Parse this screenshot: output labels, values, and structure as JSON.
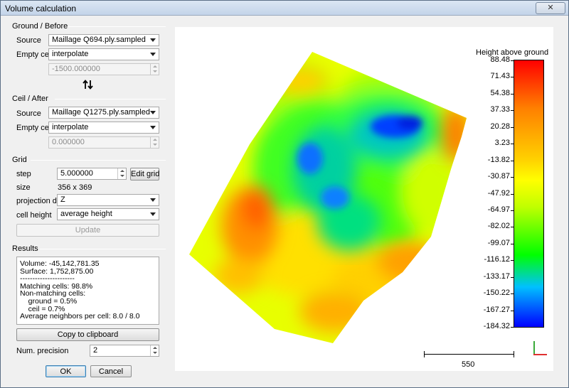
{
  "window": {
    "title": "Volume calculation",
    "close_label": "✕"
  },
  "ground": {
    "title": "Ground / Before",
    "source_label": "Source",
    "source_value": "Maillage Q694.ply.sampled",
    "empty_label": "Empty cells",
    "empty_value": "interpolate",
    "height_value": "-1500.000000"
  },
  "ceil": {
    "title": "Ceil / After",
    "source_label": "Source",
    "source_value": "Maillage Q1275.ply.sampled",
    "empty_label": "Empty cells",
    "empty_value": "interpolate",
    "height_value": "0.000000"
  },
  "grid": {
    "title": "Grid",
    "step_label": "step",
    "step_value": "5.000000",
    "edit_grid_label": "Edit grid",
    "size_label": "size",
    "size_value": "356 x 369",
    "projection_label": "projection dir.",
    "projection_value": "Z",
    "cell_height_label": "cell height",
    "cell_height_value": "average height",
    "update_label": "Update"
  },
  "results": {
    "title": "Results",
    "lines": [
      "Volume: -45,142,781.35",
      "Surface: 1,752,875.00",
      "----------------------",
      "Matching cells: 98.8%",
      "Non-matching cells:",
      "    ground = 0.5%",
      "    ceil = 0.7%",
      "Average neighbors per cell: 8.0 / 8.0"
    ],
    "copy_label": "Copy to clipboard",
    "precision_label": "Num. precision",
    "precision_value": "2"
  },
  "buttons": {
    "ok": "OK",
    "cancel": "Cancel"
  },
  "colorbar": {
    "title": "Height above ground",
    "ticks": [
      "88.48",
      "71.43",
      "54.38",
      "37.33",
      "20.28",
      "3.23",
      "-13.82",
      "-30.87",
      "-47.92",
      "-64.97",
      "-82.02",
      "-99.07",
      "-116.12",
      "-133.17",
      "-150.22",
      "-167.27",
      "-184.32"
    ]
  },
  "scale": {
    "label": "550"
  },
  "icons": {
    "swap": "swap-vertical-icon",
    "close": "close-icon",
    "axes": "axes-icon"
  }
}
